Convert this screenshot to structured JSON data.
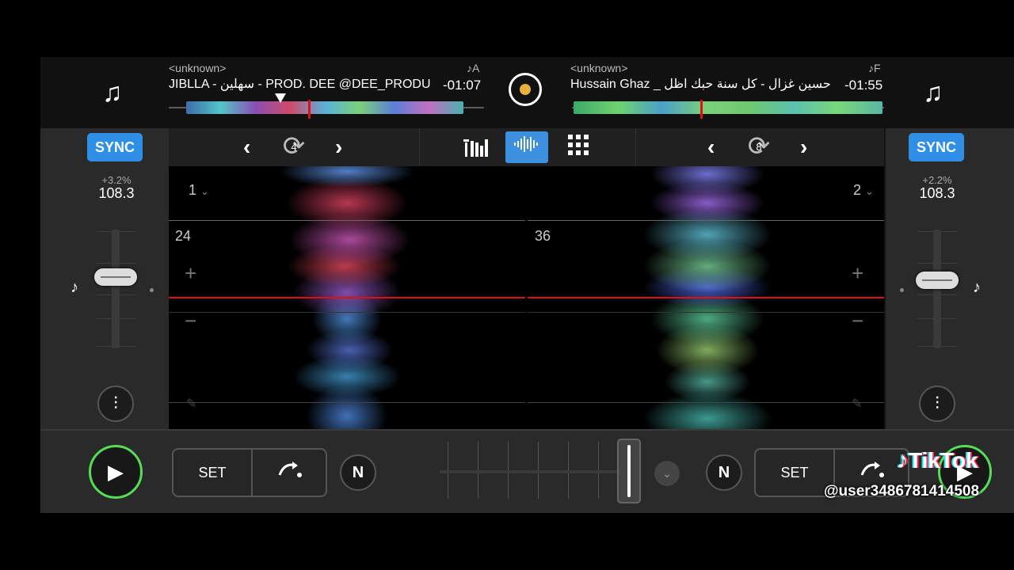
{
  "deck_a": {
    "artist": "<unknown>",
    "title": "JIBLLA - سهلين - PROD. DEE @DEE_PRODU",
    "time": "-01:07",
    "key": "♪A",
    "deck_number": "1",
    "beat_counter": "24",
    "pitch_percent": "+3.2%",
    "bpm": "108.3",
    "loop_size": "4",
    "sync_label": "SYNC"
  },
  "deck_b": {
    "artist": "<unknown>",
    "title": "Hussain Ghaz _ حسين غزال - كل سنة حبك اظل",
    "time": "-01:55",
    "key": "♪F",
    "deck_number": "2",
    "beat_counter": "36",
    "pitch_percent": "+2.2%",
    "bpm": "108.3",
    "loop_size": "8",
    "sync_label": "SYNC"
  },
  "bottom": {
    "set_label_a": "SET",
    "set_label_b": "SET",
    "n_label": "N"
  },
  "icons": {
    "music_note": "♫",
    "small_note": "♪",
    "play": "▶",
    "chevron_left": "‹",
    "chevron_right": "›",
    "loop": "⟳",
    "plus": "+",
    "minus": "−",
    "pencil": "✎",
    "eq": "⫶",
    "dropdown": "⌄"
  },
  "overlay": {
    "brand": "TikTok",
    "user": "@user3486781414508"
  },
  "colors": {
    "sync": "#2f8fe6",
    "play_ring": "#55dd55",
    "playhead": "#e01010",
    "center_dot": "#e8b23a"
  }
}
